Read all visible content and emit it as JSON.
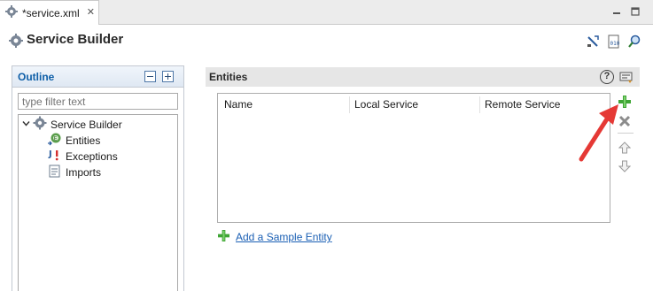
{
  "editor": {
    "tab_title": "*service.xml",
    "tab_close": "✕"
  },
  "header": {
    "title": "Service Builder"
  },
  "outline": {
    "title": "Outline",
    "filter_placeholder": "type filter text",
    "tree": {
      "root": "Service Builder",
      "children": [
        "Entities",
        "Exceptions",
        "Imports"
      ]
    }
  },
  "entities": {
    "title": "Entities",
    "help_label": "?",
    "columns": [
      "Name",
      "Local Service",
      "Remote Service"
    ],
    "rows": [],
    "add_sample_label": "Add a Sample Entity"
  },
  "colors": {
    "accent_title": "#0f5fa8",
    "link": "#1a5fb4",
    "add_green": "#3fa535",
    "annotation_red": "#e53935"
  },
  "icons": {
    "tab": "service-builder-icon",
    "add": "add-icon",
    "delete": "delete-icon",
    "move_up": "move-up-icon",
    "move_down": "move-down-icon"
  }
}
